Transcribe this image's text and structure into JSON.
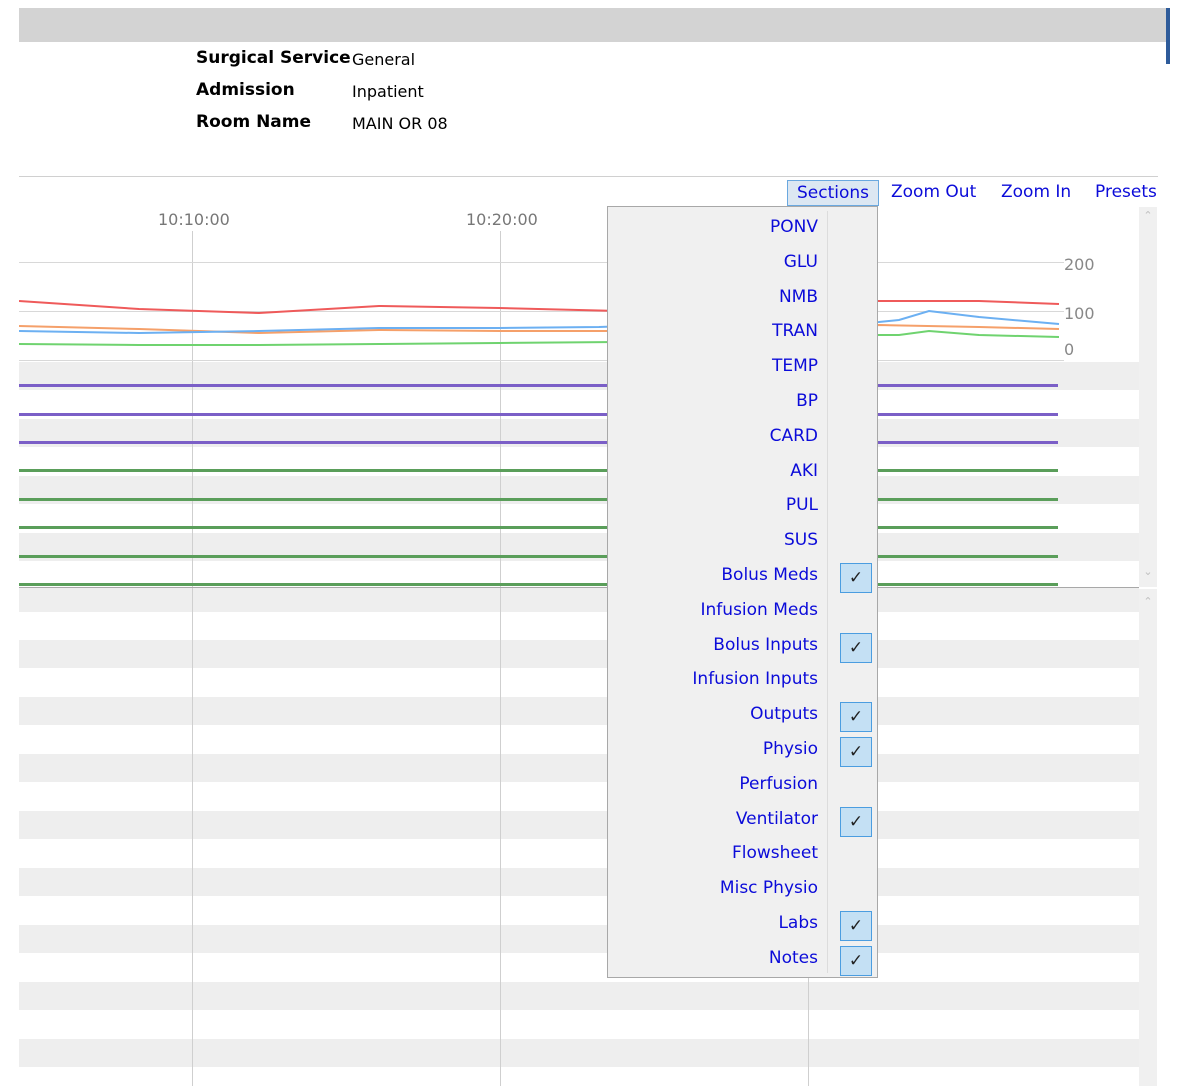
{
  "info": {
    "surgical_service_label": "Surgical Service",
    "surgical_service_value": "General",
    "admission_label": "Admission",
    "admission_value": "Inpatient",
    "room_name_label": "Room Name",
    "room_name_value": "MAIN OR 08"
  },
  "toolbar": {
    "sections": "Sections",
    "zoom_out": "Zoom Out",
    "zoom_in": "Zoom In",
    "presets": "Presets"
  },
  "timeline": {
    "t1": "10:10:00",
    "t2": "10:20:00"
  },
  "vitals_axis": {
    "max": "200",
    "mid": "100",
    "min": "0"
  },
  "colors": {
    "red_series": "#ef5a5a",
    "orange_series": "#f5a06a",
    "blue_series": "#6cb0f2",
    "green_series": "#6fd36f",
    "purple_bars": "#7b5fc7",
    "green_bars": "#5a9e5a",
    "link_blue": "#0b0bd9"
  },
  "sections_menu": {
    "items": [
      {
        "label": "PONV",
        "checked": false
      },
      {
        "label": "GLU",
        "checked": false
      },
      {
        "label": "NMB",
        "checked": false
      },
      {
        "label": "TRAN",
        "checked": false
      },
      {
        "label": "TEMP",
        "checked": false
      },
      {
        "label": "BP",
        "checked": false
      },
      {
        "label": "CARD",
        "checked": false
      },
      {
        "label": "AKI",
        "checked": false
      },
      {
        "label": "PUL",
        "checked": false
      },
      {
        "label": "SUS",
        "checked": false
      },
      {
        "label": "Bolus Meds",
        "checked": true
      },
      {
        "label": "Infusion Meds",
        "checked": false
      },
      {
        "label": "Bolus Inputs",
        "checked": true
      },
      {
        "label": "Infusion Inputs",
        "checked": false
      },
      {
        "label": "Outputs",
        "checked": true
      },
      {
        "label": "Physio",
        "checked": true
      },
      {
        "label": "Perfusion",
        "checked": false
      },
      {
        "label": "Ventilator",
        "checked": true
      },
      {
        "label": "Flowsheet",
        "checked": false
      },
      {
        "label": "Misc Physio",
        "checked": false
      },
      {
        "label": "Labs",
        "checked": true
      },
      {
        "label": "Notes",
        "checked": true
      }
    ]
  },
  "icons": {
    "check": "✓",
    "scroll_up": "⌃",
    "scroll_down": "⌄"
  }
}
